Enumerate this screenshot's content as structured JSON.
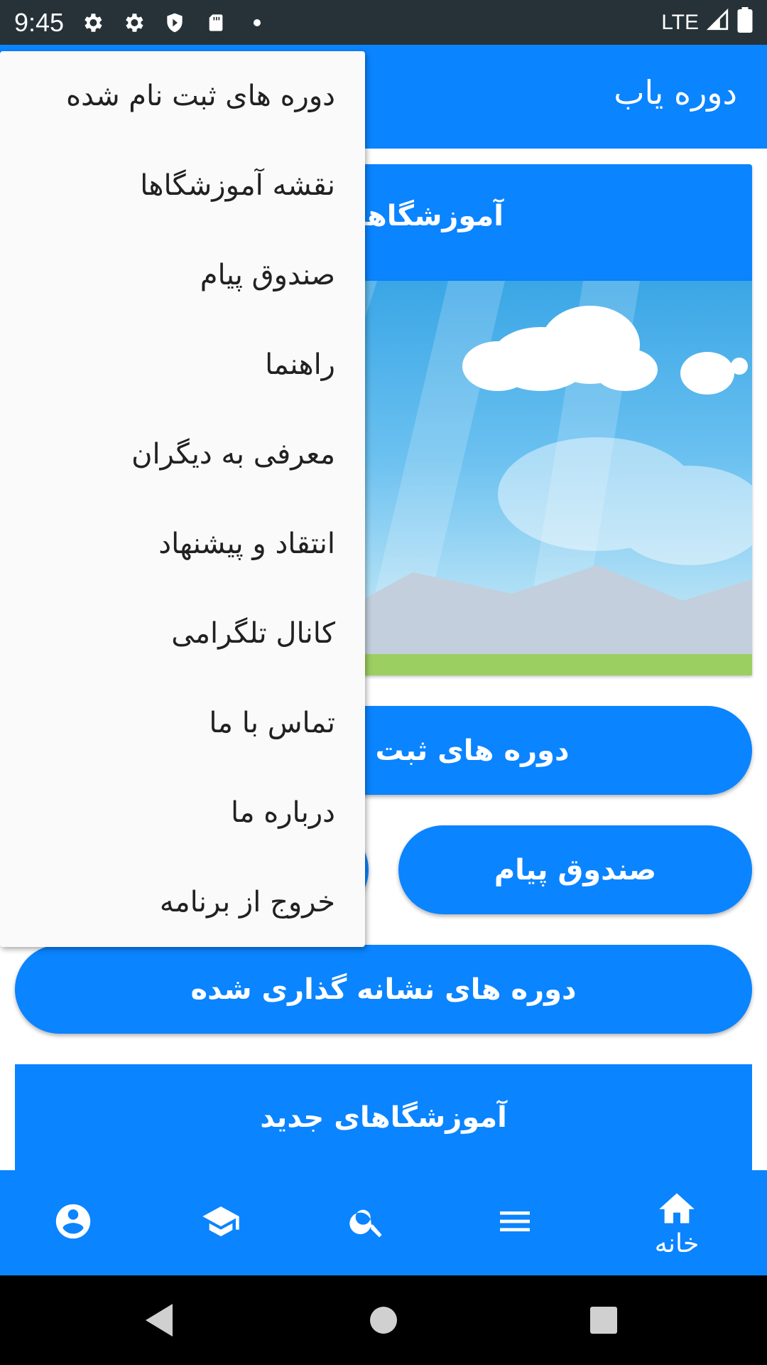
{
  "status_bar": {
    "time": "9:45",
    "network": "LTE",
    "icons": [
      "gear-icon",
      "gear-icon",
      "shield-icon",
      "sd-card-icon",
      "dot-icon",
      "signal-icon",
      "battery-icon"
    ]
  },
  "app_bar": {
    "title": "دوره یاب"
  },
  "card": {
    "title": "آموزشگاهای"
  },
  "buttons": {
    "registered": "دوره های ثبت",
    "messages": "صندوق پیام",
    "bookmarked": "دوره های نشانه گذاری شده"
  },
  "new_schools": "آموزشگاهای جدید",
  "drawer": {
    "items": [
      "دوره های ثبت نام شده",
      "نقشه آموزشگاها",
      "صندوق پیام",
      "راهنما",
      "معرفی به دیگران",
      "انتقاد و پیشنهاد",
      "کانال تلگرامی",
      "تماس با ما",
      "درباره ما",
      "خروج از برنامه"
    ]
  },
  "bottom_nav": {
    "home_label": "خانه",
    "icons": [
      "home-icon",
      "menu-icon",
      "search-icon",
      "school-icon",
      "account-icon"
    ]
  },
  "colors": {
    "primary": "#0a84ff",
    "status_bar": "#263238",
    "drawer_bg": "#fafafa"
  }
}
